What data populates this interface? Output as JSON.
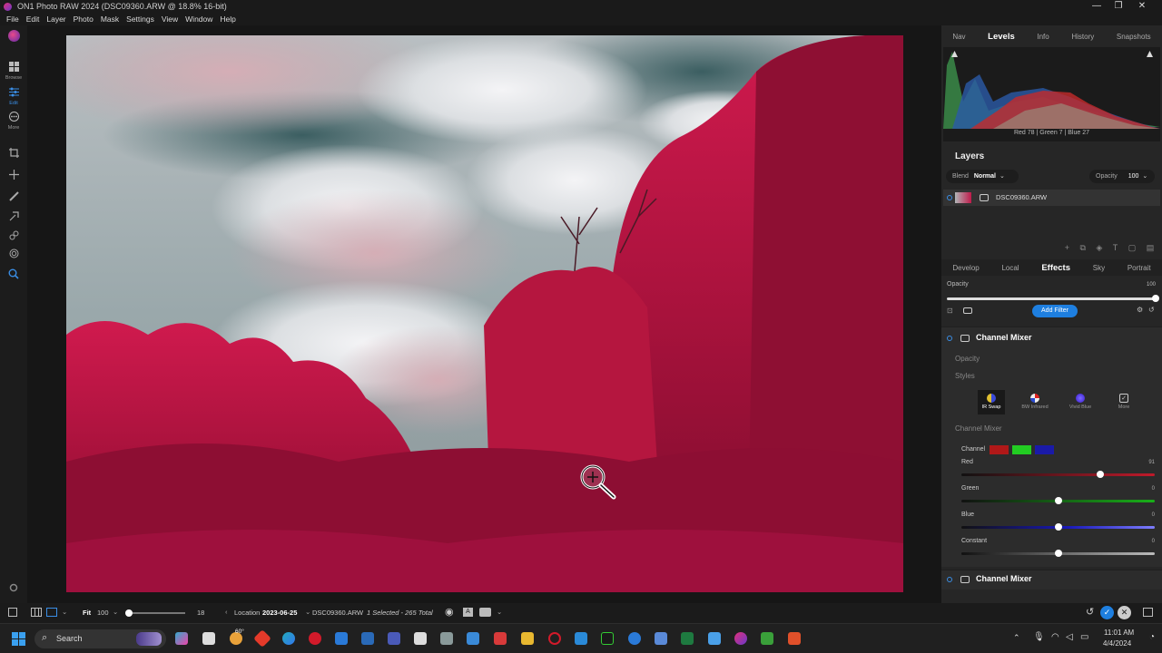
{
  "window": {
    "title": "ON1 Photo RAW 2024 (DSC09360.ARW @ 18.8% 16-bit)",
    "controls": [
      "—",
      "❐",
      "✕"
    ]
  },
  "menu": [
    "File",
    "Edit",
    "Layer",
    "Photo",
    "Mask",
    "Settings",
    "View",
    "Window",
    "Help"
  ],
  "left_toolbar": {
    "modules": [
      {
        "label": "Browse",
        "icon": "grid-icon"
      },
      {
        "label": "Edit",
        "icon": "sliders-icon"
      },
      {
        "label": "More",
        "icon": "more-icon"
      }
    ],
    "tools": [
      "crop-icon",
      "move-icon",
      "brush-icon",
      "mask-brush-icon",
      "retouch-icon",
      "fingerprint-icon",
      "zoom-icon"
    ]
  },
  "nav_tabs": [
    "Nav",
    "Levels",
    "Info",
    "History",
    "Snapshots"
  ],
  "nav_active": "Levels",
  "histogram": {
    "readout": "Red 78 | Green 7 | Blue 27",
    "red": 78,
    "green": 7,
    "blue": 27
  },
  "layers": {
    "title": "Layers",
    "blend_label": "Blend",
    "blend_value": "Normal",
    "opacity_label": "Opacity",
    "opacity_value": "100",
    "items": [
      {
        "name": "DSC09360.ARW"
      }
    ]
  },
  "edit_tabs": [
    "Develop",
    "Local",
    "Effects",
    "Sky",
    "Portrait"
  ],
  "edit_active": "Effects",
  "effects": {
    "opacity_label": "Opacity",
    "opacity_value": "100",
    "opacity_level": 1.0,
    "add_filter_label": "Add Filter",
    "filter_title": "Channel Mixer",
    "filter_opacity_label": "Opacity",
    "styles_label": "Styles",
    "styles": [
      {
        "label": "IR Swap",
        "icon": "ir-swap-icon",
        "active": true
      },
      {
        "label": "BW Infrared",
        "icon": "bw-infrared-icon",
        "active": false
      },
      {
        "label": "Vivid Blue",
        "icon": "vivid-blue-icon",
        "active": false
      },
      {
        "label": "More",
        "icon": "more-styles-icon",
        "active": false
      }
    ],
    "mixer_section_label": "Channel Mixer",
    "channel_label": "Channel",
    "channel_swatches": [
      "#b01818",
      "#22cc22",
      "#1a1aa8"
    ],
    "sliders": [
      {
        "label": "Red",
        "value": "91",
        "level": 0.72,
        "track": "linear-gradient(90deg,#111,#c01a2a)"
      },
      {
        "label": "Green",
        "value": "0",
        "level": 0.5,
        "track": "linear-gradient(90deg,#111,#18b018)"
      },
      {
        "label": "Blue",
        "value": "0",
        "level": 0.5,
        "track": "linear-gradient(90deg,#111,#1818b8 55%,#7e7eff)"
      },
      {
        "label": "Constant",
        "value": "0",
        "level": 0.5,
        "track": "linear-gradient(90deg,#111,#bbb)"
      }
    ],
    "second_filter_title": "Channel Mixer"
  },
  "bottom_bar": {
    "fit_label": "Fit",
    "zoom_value": "100",
    "zoom_level": 0.0,
    "thumb_size": "18",
    "location_label": "Location",
    "location_date": "2023-06-25",
    "filename": "DSC09360.ARW",
    "selection": "1 Selected - 265 Total"
  },
  "taskbar": {
    "search_placeholder": "Search",
    "weather": "60°",
    "time": "11:01 AM",
    "date": "4/4/2024"
  },
  "colors": {
    "accent": "#1e7fe0",
    "panel": "#262626",
    "foliage": "#b01845"
  }
}
